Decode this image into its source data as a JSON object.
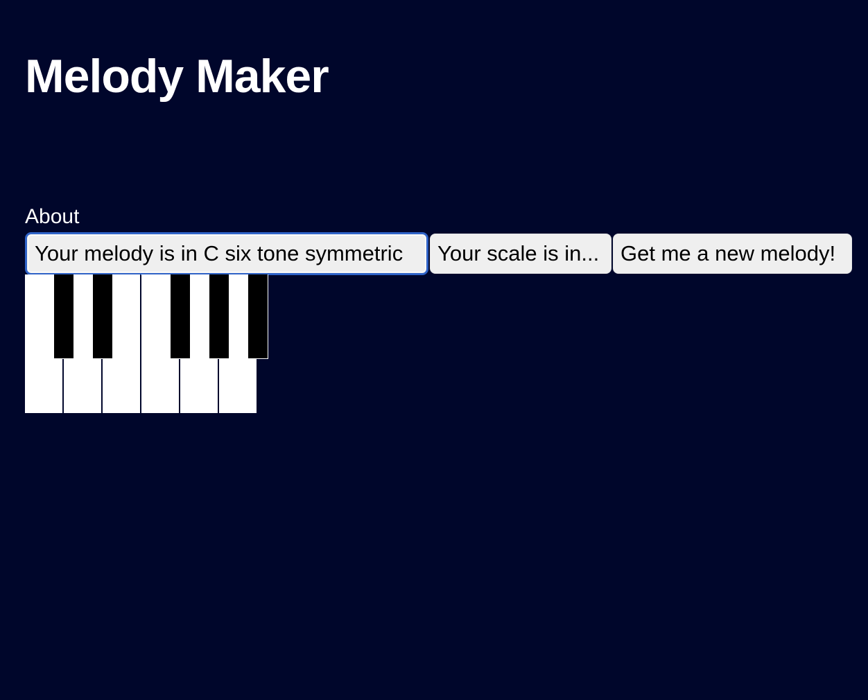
{
  "app": {
    "title": "Melody Maker"
  },
  "nav": {
    "about_label": "About"
  },
  "controls": {
    "melody_button_label": "Your melody is in C six tone symmetric",
    "scale_button_label": "Your scale is in...",
    "new_melody_button_label": "Get me a new melody!"
  },
  "piano": {
    "white_keys": [
      "white-key-1",
      "white-key-2",
      "white-key-3",
      "white-key-4",
      "white-key-5",
      "white-key-6"
    ],
    "black_keys": [
      "black-key-1",
      "black-key-2",
      "black-key-3",
      "black-key-4",
      "black-key-5"
    ]
  },
  "colors": {
    "background": "#00062b",
    "button_background": "#efefef",
    "focus_ring": "#2f63c8",
    "white_key": "#ffffff",
    "black_key": "#000000"
  }
}
